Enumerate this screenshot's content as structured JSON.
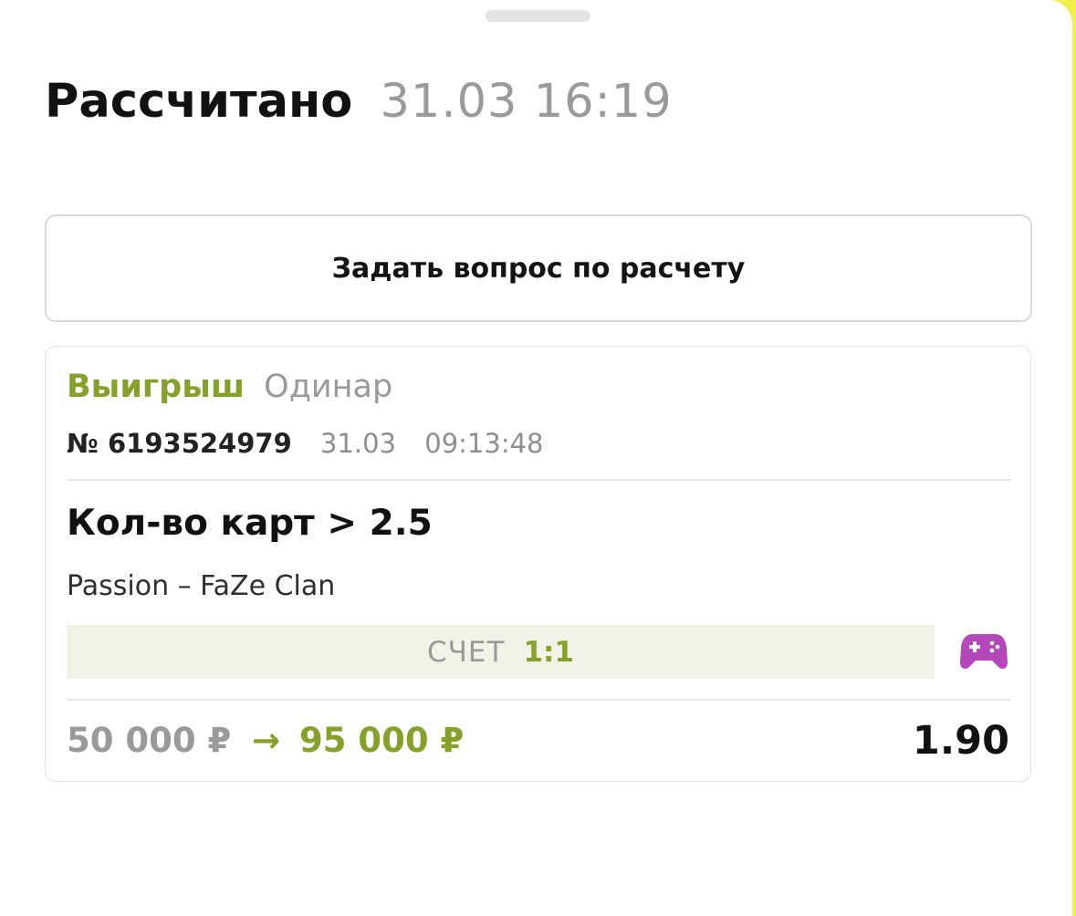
{
  "header": {
    "title": "Рассчитано",
    "timestamp": "31.03 16:19"
  },
  "ask_button": {
    "label": "Задать вопрос по расчету"
  },
  "bet": {
    "outcome": "Выигрыш",
    "type": "Одинар",
    "number": "№ 6193524979",
    "date": "31.03",
    "time": "09:13:48",
    "market": "Кол-во карт > 2.5",
    "match": "Passion – FaZe Clan",
    "score_label": "СЧЕТ",
    "score_value": "1:1",
    "sport_icon": "gamepad-icon",
    "stake": "50 000 ₽",
    "arrow": "→",
    "payout": "95 000 ₽",
    "odds": "1.90"
  },
  "colors": {
    "accent_win": "#86a12a",
    "esports_icon": "#b548b9",
    "score_bg": "#f1f3e7",
    "muted_text": "#9a9a9a",
    "page_edge": "#f2ef4a"
  }
}
